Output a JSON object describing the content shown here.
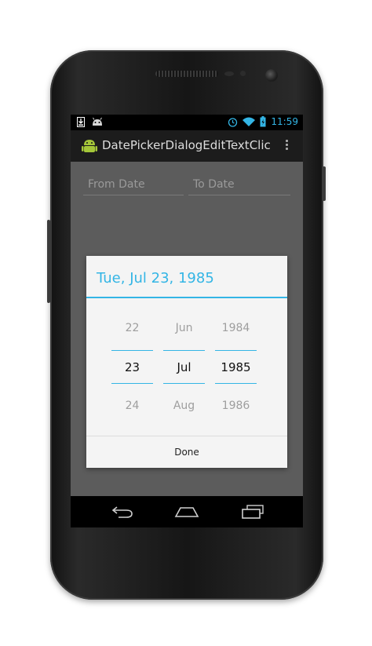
{
  "status_bar": {
    "time": "11:59",
    "icons": [
      "download-icon",
      "android-icon",
      "alarm-icon",
      "wifi-icon",
      "battery-icon"
    ]
  },
  "action_bar": {
    "title": "DatePickerDialogEditTextClic..."
  },
  "form": {
    "from_date_placeholder": "From Date",
    "to_date_placeholder": "To Date"
  },
  "date_dialog": {
    "title": "Tue, Jul 23, 1985",
    "day": {
      "prev": "22",
      "current": "23",
      "next": "24"
    },
    "month": {
      "prev": "Jun",
      "current": "Jul",
      "next": "Aug"
    },
    "year": {
      "prev": "1984",
      "current": "1985",
      "next": "1986"
    },
    "done_label": "Done"
  },
  "nav_bar": {
    "icons": [
      "back-icon",
      "home-icon",
      "recent-apps-icon"
    ]
  },
  "colors": {
    "accent": "#33b5e5",
    "dim_background": "#5c5c5c",
    "dialog_background": "#f4f4f4"
  }
}
